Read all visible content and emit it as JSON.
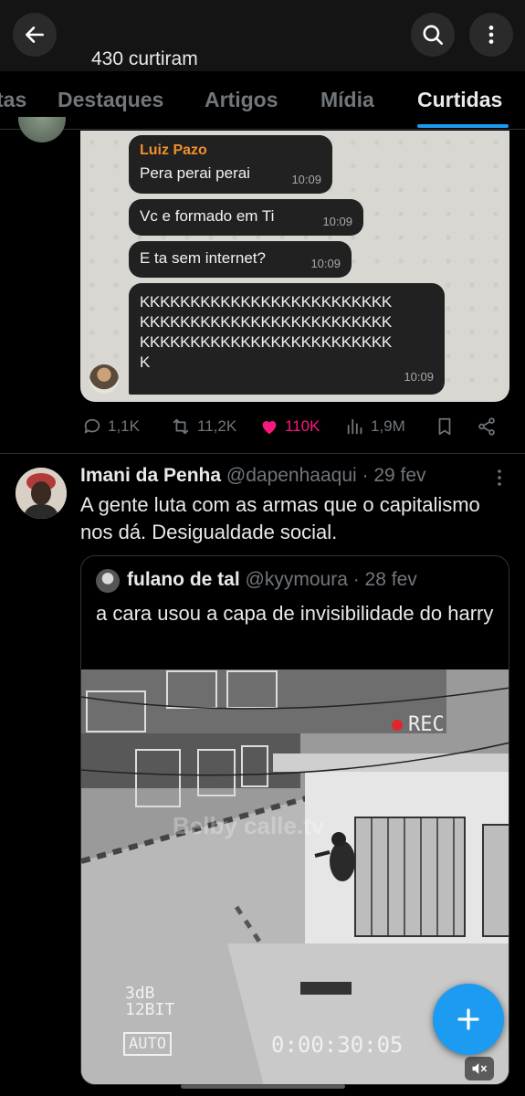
{
  "header": {
    "likes_count_label": "430 curtiram",
    "back_icon": "arrow-left-icon",
    "search_icon": "search-icon",
    "more_icon": "more-vertical-icon"
  },
  "tabs": [
    {
      "label": "tas",
      "active": false
    },
    {
      "label": "Destaques",
      "active": false
    },
    {
      "label": "Artigos",
      "active": false
    },
    {
      "label": "Mídia",
      "active": false
    },
    {
      "label": "Curtidas",
      "active": true
    }
  ],
  "tweet1": {
    "chat": {
      "sender": "Luiz Pazo",
      "messages": [
        {
          "text": "Pera perai perai",
          "time": "10:09"
        },
        {
          "text": "Vc e formado em Ti",
          "time": "10:09"
        },
        {
          "text": "E ta sem internet?",
          "time": "10:09"
        }
      ],
      "long_message": {
        "lines": [
          "KKKKKKKKKKKKKKKKKKKKKKKKK",
          "KKKKKKKKKKKKKKKKKKKKKKKKK",
          "KKKKKKKKKKKKKKKKKKKKKKKKK",
          "K"
        ],
        "time": "10:09"
      }
    },
    "stats": {
      "replies": "1,1K",
      "reposts": "11,2K",
      "likes": "110K",
      "views": "1,9M"
    }
  },
  "tweet2": {
    "author_name": "Imani da Penha",
    "handle": "@dapenhaaqui",
    "date": "· 29 fev",
    "text": "A gente luta com as armas que o capitalismo nos dá. Desigualdade social.",
    "quote": {
      "author_name": "fulano de tal",
      "handle": "@kyymoura",
      "date": "· 28 fev",
      "text": "a cara usou a capa de invisibilidade do harry",
      "video": {
        "rec_label": "REC",
        "watermark": "Belby calle.tv",
        "db_label": "3dB",
        "bit_label": "12BIT",
        "auto_label": "AUTO",
        "timecode": "0:00:30:05"
      }
    }
  },
  "colors": {
    "accent": "#1d9bf0",
    "like": "#f91880",
    "muted": "#71767b",
    "rec": "#e0262b"
  }
}
